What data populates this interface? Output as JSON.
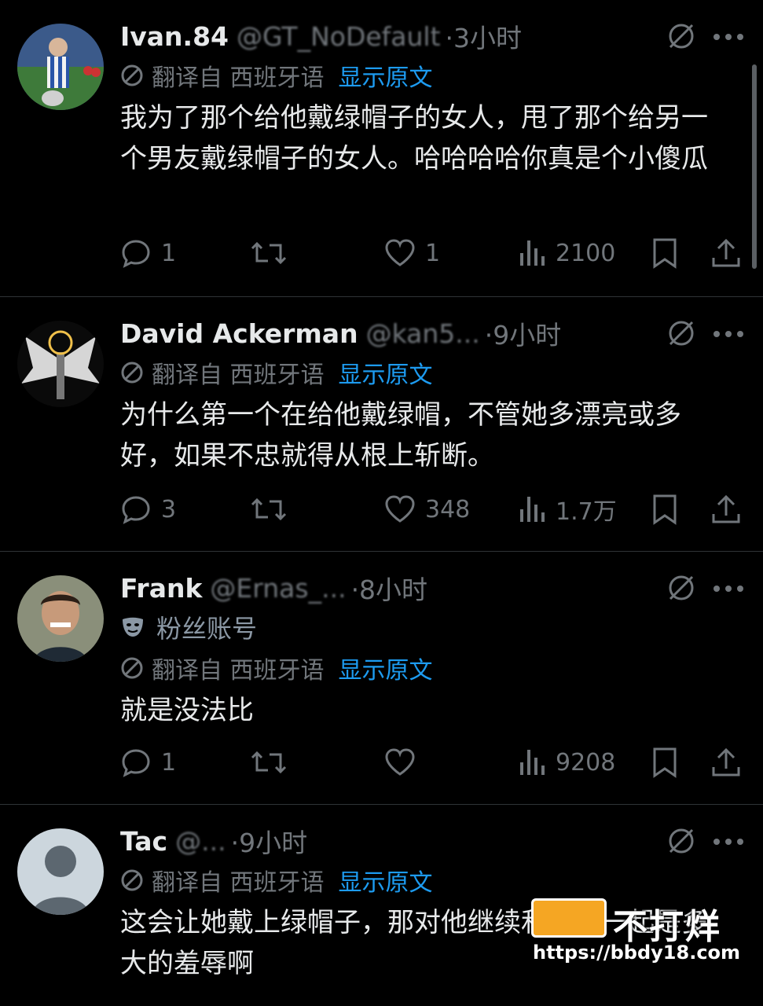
{
  "tweets": [
    {
      "name": "Ivan.84",
      "handle": "@GT_NoDefault",
      "time": "·3小时",
      "fan_label": "",
      "translate_label": "翻译自 西班牙语",
      "show_original": "显示原文",
      "text": "我为了那个给他戴绿帽子的女人，甩了那个给另一个男友戴绿帽子的女人。哈哈哈哈你真是个小傻瓜",
      "replies": "1",
      "retweets": "",
      "likes": "1",
      "views": "2100"
    },
    {
      "name": "David Ackerman",
      "handle": "@kan5...",
      "time": "·9小时",
      "fan_label": "",
      "translate_label": "翻译自 西班牙语",
      "show_original": "显示原文",
      "text": "为什么第一个在给他戴绿帽，不管她多漂亮或多好，如果不忠就得从根上斩断。",
      "replies": "3",
      "retweets": "",
      "likes": "348",
      "views": "1.7万"
    },
    {
      "name": "Frank",
      "handle": "@Ernas_...",
      "time": "·8小时",
      "fan_label": "粉丝账号",
      "translate_label": "翻译自 西班牙语",
      "show_original": "显示原文",
      "text": "就是没法比",
      "replies": "1",
      "retweets": "",
      "likes": "",
      "views": "9208"
    },
    {
      "name": "Tac",
      "handle": "@...",
      "time": "·9小时",
      "fan_label": "",
      "translate_label": "翻译自 西班牙语",
      "show_original": "显示原文",
      "text": "这会让她戴上绿帽子，那对他继续和她在一起是多大的羞辱啊",
      "replies": "",
      "retweets": "",
      "likes": "",
      "views": ""
    }
  ],
  "watermark": {
    "title": "不打烊",
    "url": "https://bbdy18.com"
  },
  "colors": {
    "background": "#000000",
    "text": "#e7e9ea",
    "muted": "#71767b",
    "link": "#1d9bf0",
    "divider": "#2f3336"
  }
}
